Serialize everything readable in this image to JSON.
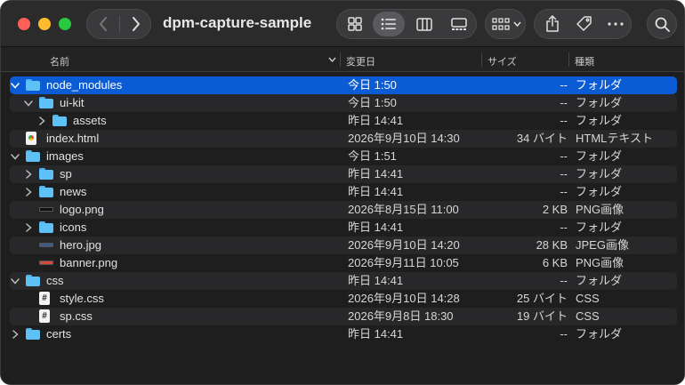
{
  "window": {
    "title": "dpm-capture-sample"
  },
  "toolbar": {
    "back_icon": "chevron-left-icon",
    "forward_icon": "chevron-right-icon",
    "view_icons": [
      "grid-icon",
      "list-icon",
      "columns-icon",
      "gallery-icon"
    ],
    "active_view": "list-icon",
    "group_icon": "group-by-icon",
    "action_icons": [
      "share-icon",
      "tag-icon",
      "more-icon"
    ],
    "search_icon": "search-icon"
  },
  "columns": {
    "name": "名前",
    "date": "変更日",
    "size": "サイズ",
    "kind": "種類"
  },
  "colors": {
    "selection": "#0a5bd4",
    "folder": "#5ec1f5",
    "background": "#1e1e1e"
  },
  "rows": [
    {
      "name": "node_modules",
      "date": "今日 1:50",
      "size": "--",
      "kind": "フォルダ",
      "type": "folder",
      "depth": 0,
      "chevron": "down"
    },
    {
      "name": "ui-kit",
      "date": "今日 1:50",
      "size": "--",
      "kind": "フォルダ",
      "type": "folder",
      "depth": 1,
      "chevron": "down"
    },
    {
      "name": "assets",
      "date": "昨日 14:41",
      "size": "--",
      "kind": "フォルダ",
      "type": "folder",
      "depth": 2,
      "chevron": "right"
    },
    {
      "name": "index.html",
      "date": "2026年9月10日 14:30",
      "size": "34 バイト",
      "kind": "HTMLテキスト",
      "type": "html",
      "depth": 0,
      "chevron": ""
    },
    {
      "name": "images",
      "date": "今日 1:51",
      "size": "--",
      "kind": "フォルダ",
      "type": "folder",
      "depth": 0,
      "chevron": "down"
    },
    {
      "name": "sp",
      "date": "昨日 14:41",
      "size": "--",
      "kind": "フォルダ",
      "type": "folder",
      "depth": 1,
      "chevron": "right"
    },
    {
      "name": "news",
      "date": "昨日 14:41",
      "size": "--",
      "kind": "フォルダ",
      "type": "folder",
      "depth": 1,
      "chevron": "right"
    },
    {
      "name": "logo.png",
      "date": "2026年8月15日 11:00",
      "size": "2 KB",
      "kind": "PNG画像",
      "type": "img-dark",
      "depth": 1,
      "chevron": ""
    },
    {
      "name": "icons",
      "date": "昨日 14:41",
      "size": "--",
      "kind": "フォルダ",
      "type": "folder",
      "depth": 1,
      "chevron": "right"
    },
    {
      "name": "hero.jpg",
      "date": "2026年9月10日 14:20",
      "size": "28 KB",
      "kind": "JPEG画像",
      "type": "img-blue",
      "depth": 1,
      "chevron": ""
    },
    {
      "name": "banner.png",
      "date": "2026年9月11日 10:05",
      "size": "6 KB",
      "kind": "PNG画像",
      "type": "img-red",
      "depth": 1,
      "chevron": ""
    },
    {
      "name": "css",
      "date": "昨日 14:41",
      "size": "--",
      "kind": "フォルダ",
      "type": "folder",
      "depth": 0,
      "chevron": "down"
    },
    {
      "name": "style.css",
      "date": "2026年9月10日 14:28",
      "size": "25 バイト",
      "kind": "CSS",
      "type": "css",
      "depth": 1,
      "chevron": ""
    },
    {
      "name": "sp.css",
      "date": "2026年9月8日 18:30",
      "size": "19 バイト",
      "kind": "CSS",
      "type": "css",
      "depth": 1,
      "chevron": ""
    },
    {
      "name": "certs",
      "date": "昨日 14:41",
      "size": "--",
      "kind": "フォルダ",
      "type": "folder",
      "depth": 0,
      "chevron": "right"
    }
  ]
}
